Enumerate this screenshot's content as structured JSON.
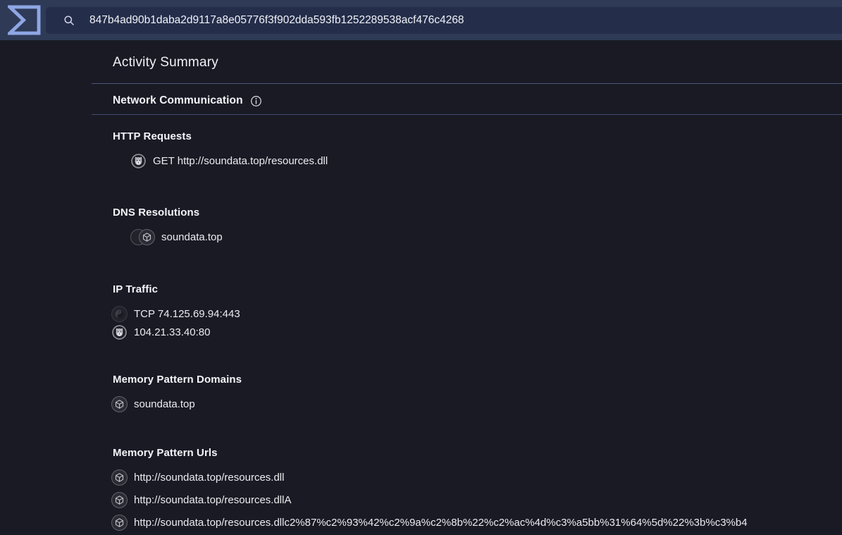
{
  "topbar": {
    "logo_name": "triage-logo",
    "search": {
      "value": "847b4ad90b1daba2d9117a8e05776f3f902dda593fb1252289538acf476c4268"
    }
  },
  "page": {
    "title": "Activity Summary",
    "section": {
      "title": "Network Communication",
      "info_icon": "info-icon",
      "groups": [
        {
          "heading": "HTTP Requests",
          "indent": true,
          "rows": [
            {
              "icon": "malware-family-icon",
              "text": "GET http://soundata.top/resources.dll"
            }
          ]
        },
        {
          "heading": "DNS Resolutions",
          "indent": true,
          "rows": [
            {
              "icon": "stacked-domain-icon",
              "text": "soundata.top"
            }
          ]
        },
        {
          "heading": "IP Traffic",
          "indent": false,
          "rows": [
            {
              "icon": "network-swirl-icon",
              "text": "TCP 74.125.69.94:443"
            },
            {
              "icon": "malware-family-icon",
              "text": "104.21.33.40:80"
            }
          ]
        },
        {
          "heading": "Memory Pattern Domains",
          "indent": false,
          "rows": [
            {
              "icon": "package-icon",
              "text": "soundata.top"
            }
          ]
        },
        {
          "heading": "Memory Pattern Urls",
          "indent": false,
          "rows": [
            {
              "icon": "package-icon",
              "text": "http://soundata.top/resources.dll"
            },
            {
              "icon": "package-icon",
              "text": "http://soundata.top/resources.dllA"
            },
            {
              "icon": "package-icon",
              "text": "http://soundata.top/resources.dllc2%87%c2%93%42%c2%9a%c2%8b%22%c2%ac%4d%c3%a5bb%31%64%5d%22%3b%c3%b4"
            }
          ]
        }
      ]
    }
  },
  "colors": {
    "topbar_bg": "#2e3a56",
    "searchbox_bg": "#242e4b",
    "logo_blue": "#8fa6e4",
    "page_bg": "#1a1a24",
    "divider": "#4a5578",
    "text": "#efeff4"
  }
}
